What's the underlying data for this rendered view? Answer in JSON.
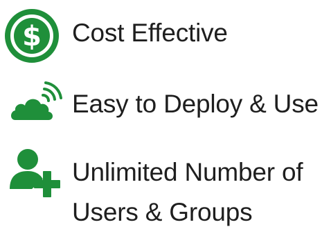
{
  "colors": {
    "accent": "#1f8f3a",
    "text": "#1e1e1e",
    "background": "#ffffff"
  },
  "features": [
    {
      "icon": "dollar-coin-icon",
      "label": "Cost Effective"
    },
    {
      "icon": "cloud-signal-icon",
      "label": "Easy to Deploy & Use"
    },
    {
      "icon": "add-user-icon",
      "label_line1": "Unlimited Number of",
      "label_line2": "Users & Groups"
    }
  ]
}
